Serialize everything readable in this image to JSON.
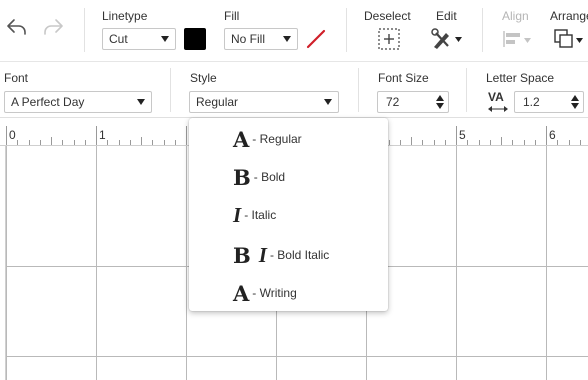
{
  "toolbar": {
    "linetype": {
      "label": "Linetype",
      "value": "Cut"
    },
    "fill": {
      "label": "Fill",
      "value": "No Fill"
    },
    "deselect_label": "Deselect",
    "edit_label": "Edit",
    "align_label": "Align",
    "arrange_label": "Arrange"
  },
  "text_toolbar": {
    "font": {
      "label": "Font",
      "value": "A Perfect Day"
    },
    "style": {
      "label": "Style",
      "value": "Regular"
    },
    "font_size": {
      "label": "Font Size",
      "value": "72"
    },
    "letter_space": {
      "label": "Letter Space",
      "icon_text": "VA",
      "value": "1.2"
    }
  },
  "ruler": {
    "numbers": [
      "0",
      "1",
      "5",
      "6"
    ]
  },
  "style_menu": {
    "options": [
      {
        "glyph": "A",
        "glyph2": "",
        "label": "- Regular"
      },
      {
        "glyph": "B",
        "glyph2": "",
        "label": "- Bold"
      },
      {
        "glyph": "I",
        "glyph2": "",
        "label": "- Italic"
      },
      {
        "glyph": "B",
        "glyph2": "I",
        "label": "- Bold Italic"
      },
      {
        "glyph": "A",
        "glyph2": "",
        "label": "- Writing"
      }
    ]
  },
  "colors": {
    "line_swatch": "#000000",
    "fill_slash": "#d0202a",
    "disabled": "#b5b5b5"
  }
}
